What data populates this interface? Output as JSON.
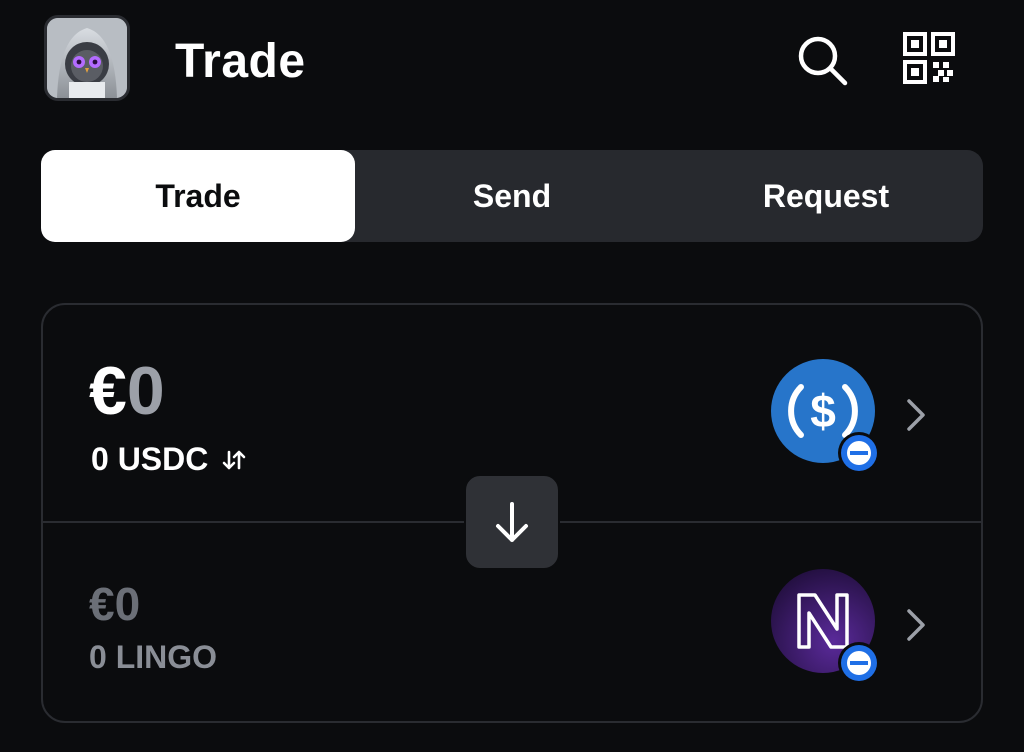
{
  "header": {
    "title": "Trade",
    "avatar_icon": "owl-avatar",
    "search_icon": "search-icon",
    "qr_icon": "qr-code-icon"
  },
  "tabs": [
    {
      "label": "Trade",
      "active": true
    },
    {
      "label": "Send",
      "active": false
    },
    {
      "label": "Request",
      "active": false
    }
  ],
  "from": {
    "currency_symbol": "€",
    "amount": "0",
    "token_amount": "0 USDC",
    "token_icon": "usdc-icon",
    "token_color": "#2775ca"
  },
  "to": {
    "currency_symbol": "€",
    "amount": "0",
    "token_amount": "0 LINGO",
    "token_icon": "lingo-icon",
    "token_color": "#3a1a66"
  },
  "flip_icon": "arrow-down-icon",
  "colors": {
    "background": "#0b0c0e",
    "surface": "#27292e",
    "badge": "#1f6fe6"
  }
}
